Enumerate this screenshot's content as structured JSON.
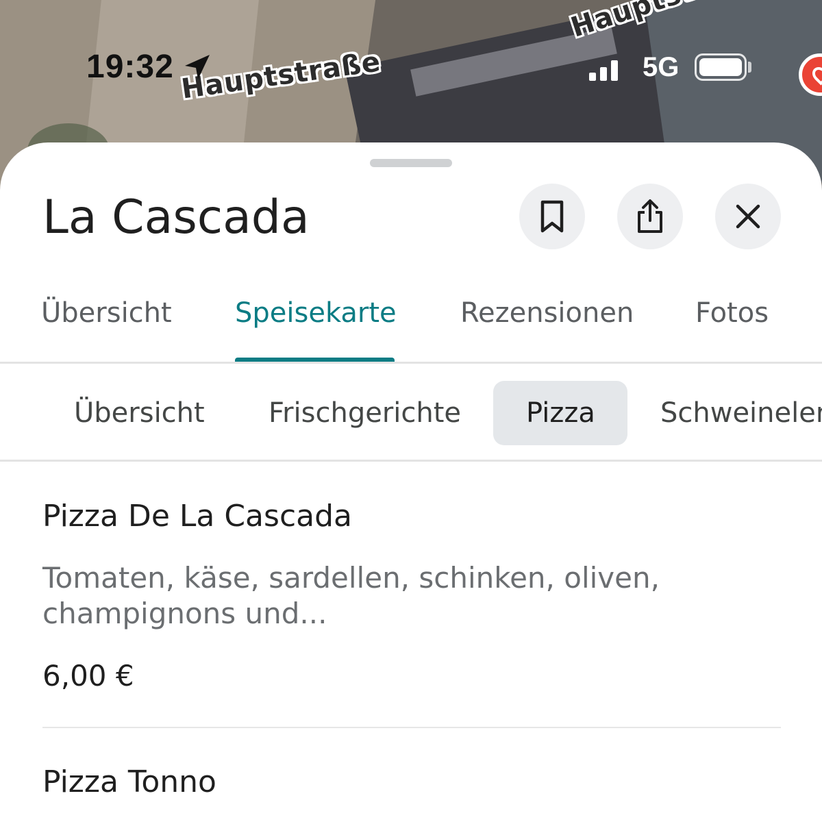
{
  "status_bar": {
    "time": "19:32",
    "network": "5G",
    "icons": [
      "location-arrow-icon",
      "signal-icon",
      "battery-icon"
    ]
  },
  "map": {
    "street_labels": [
      "Hauptstraße",
      "Hauptst"
    ],
    "pin_icon": "map-pin-icon"
  },
  "place": {
    "name": "La Cascada",
    "actions": [
      {
        "icon": "bookmark-icon"
      },
      {
        "icon": "share-icon"
      },
      {
        "icon": "close-icon"
      }
    ]
  },
  "tabs": [
    {
      "label": "Übersicht",
      "active": false
    },
    {
      "label": "Speisekarte",
      "active": true
    },
    {
      "label": "Rezensionen",
      "active": false
    },
    {
      "label": "Fotos",
      "active": false
    }
  ],
  "menu_categories": [
    {
      "label": "Übersicht",
      "active": false
    },
    {
      "label": "Frischgerichte",
      "active": false
    },
    {
      "label": "Pizza",
      "active": true
    },
    {
      "label": "Schweineler",
      "active": false
    }
  ],
  "menu_items": [
    {
      "name": "Pizza De La Cascada",
      "description": "Tomaten, käse, sardellen, schinken, oliven, champignons und...",
      "price": "6,00 €"
    },
    {
      "name": "Pizza Tonno"
    }
  ],
  "colors": {
    "accent": "#0b7c84",
    "chip_active_bg": "#e4e7ea",
    "icon_button_bg": "#eeeff1",
    "pin": "#ea4335"
  }
}
